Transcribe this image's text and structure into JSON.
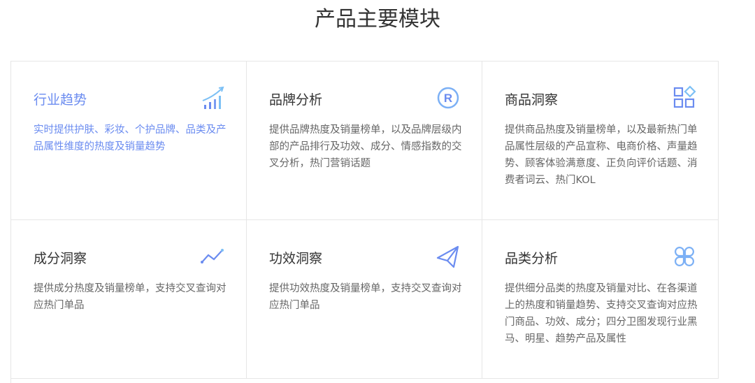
{
  "page_title": "产品主要模块",
  "modules": [
    {
      "title": "行业趋势",
      "desc": "实时提供护肤、彩妆、个护品牌、品类及产品属性维度的热度及销量趋势",
      "icon": "trend-chart-icon"
    },
    {
      "title": "品牌分析",
      "desc": "提供品牌热度及销量榜单，以及品牌层级内部的产品排行及功效、成分、情感指数的交叉分析，热门营销话题",
      "icon": "registered-icon"
    },
    {
      "title": "商品洞察",
      "desc": "提供商品热度及销量榜单，以及最新热门单品属性层级的产品宣称、电商价格、声量趋势、顾客体验满意度、正负向评价话题、消费者词云、热门KOL",
      "icon": "apps-icon"
    },
    {
      "title": "成分洞察",
      "desc": "提供成分热度及销量榜单，支持交叉查询对应热门单品",
      "icon": "line-chart-icon"
    },
    {
      "title": "功效洞察",
      "desc": "提供功效热度及销量榜单，支持交叉查询对应热门单品",
      "icon": "paper-plane-icon"
    },
    {
      "title": "品类分析",
      "desc": "提供细分品类的热度及销量对比、在各渠道上的热度和销量趋势、支持交叉查询对应热门商品、功效、成分；四分卫图发现行业黑马、明星、趋势产品及属性",
      "icon": "category-icon"
    }
  ],
  "colors": {
    "accent": "#6b8cf0",
    "icon_light": "#7cc0f5"
  }
}
